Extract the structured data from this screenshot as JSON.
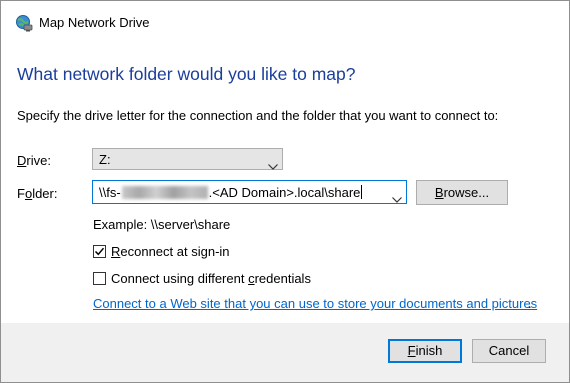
{
  "window": {
    "title": "Map Network Drive",
    "app_icon": "network-drive-icon"
  },
  "main": {
    "heading": "What network folder would you like to map?",
    "instruction": "Specify the drive letter for the connection and the folder that you want to connect to:"
  },
  "drive": {
    "label_prefix": "",
    "label_mnemonic": "D",
    "label_rest": "rive:",
    "value": "Z:"
  },
  "folder": {
    "label_prefix": "F",
    "label_mnemonic": "o",
    "label_rest": "lder:",
    "value_prefix": "\\\\fs-",
    "value_suffix": ".<AD Domain>.local\\share",
    "browse_mnemonic": "B",
    "browse_rest": "rowse..."
  },
  "example": "Example: \\\\server\\share",
  "options": {
    "reconnect": {
      "checked": true,
      "label_mnemonic": "R",
      "label_rest": "econnect at sign-in"
    },
    "different_credentials": {
      "checked": false,
      "label_prefix": "Connect using different ",
      "label_mnemonic": "c",
      "label_rest": "redentials"
    }
  },
  "link": {
    "text": "Connect to a Web site that you can use to store your documents and pictures",
    "trailing": "."
  },
  "footer": {
    "finish_mnemonic": "F",
    "finish_rest": "inish",
    "cancel_label": "Cancel"
  },
  "colors": {
    "heading": "#1a3e9b",
    "link": "#0066cc",
    "focus_border": "#0078d7",
    "footer_bg": "#f0f0f0"
  }
}
